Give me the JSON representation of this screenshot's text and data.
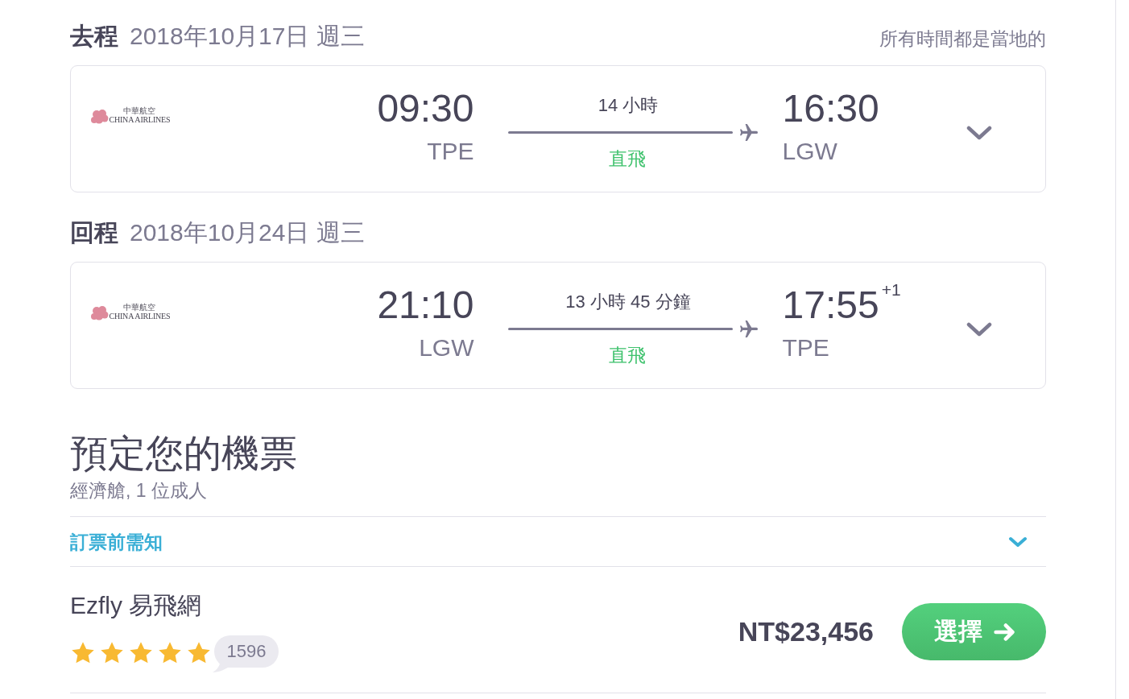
{
  "legs": [
    {
      "label": "去程",
      "date": "2018年10月17日 週三",
      "note": "所有時間都是當地的",
      "airline": {
        "name_cn": "中華航空",
        "name_en": "CHINA AIRLINES"
      },
      "departure": {
        "time": "09:30",
        "airport": "TPE"
      },
      "duration": "14 小時",
      "stops": "直飛",
      "arrival": {
        "time": "16:30",
        "airport": "LGW"
      },
      "expanded": false
    },
    {
      "label": "回程",
      "date": "2018年10月24日 週三",
      "airline": {
        "name_cn": "中華航空",
        "name_en": "CHINA AIRLINES"
      },
      "departure": {
        "time": "21:10",
        "airport": "LGW"
      },
      "duration": "13 小時 45 分鐘",
      "stops": "直飛",
      "arrival": {
        "time": "17:55",
        "airport": "TPE",
        "day_offset": "+1"
      },
      "expanded": false
    }
  ],
  "booking": {
    "title": "預定您的機票",
    "subtitle": "經濟艙, 1 位成人",
    "notice": {
      "label": "訂票前需知",
      "expanded": false
    },
    "offers": [
      {
        "provider": "Ezfly 易飛網",
        "stars": 5,
        "reviews": "1596",
        "price": "NT$23,456",
        "button": "選擇"
      }
    ]
  }
}
